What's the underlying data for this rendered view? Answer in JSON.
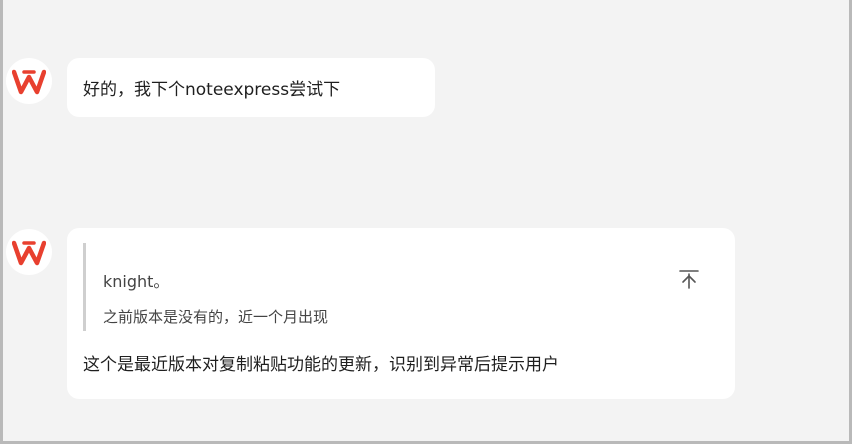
{
  "messages": [
    {
      "avatar_icon": "wps-logo-icon",
      "text": "好的，我下个noteexpress尝试下"
    },
    {
      "avatar_icon": "wps-logo-icon",
      "quote": {
        "author": "knight。",
        "text": "之前版本是没有的，近一个月出现",
        "action_icon": "jump-to-original-icon"
      },
      "text": "这个是最近版本对复制粘贴功能的更新，识别到异常后提示用户"
    }
  ],
  "colors": {
    "logo_red": "#e8402f",
    "background": "#f3f3f3",
    "bubble": "#ffffff"
  }
}
